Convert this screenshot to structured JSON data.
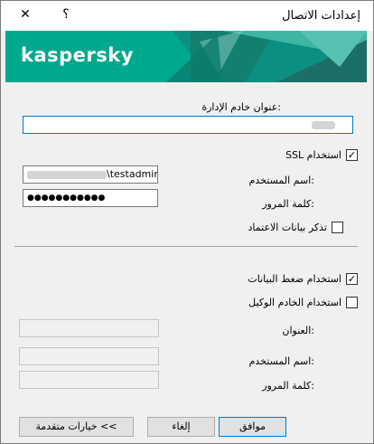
{
  "window": {
    "title": "إعدادات الاتصال",
    "close_symbol": "✕",
    "help_symbol": "؟"
  },
  "banner": {
    "logo_text": "kaspersky",
    "accent_color": "#00a88e"
  },
  "server": {
    "label": "عنوان خادم الإدارة:"
  },
  "ssl": {
    "label": "استخدام SSL",
    "checked": true
  },
  "credentials": {
    "username_label": "اسم المستخدم:",
    "username_value": "\\testadmin",
    "password_label": "كلمة المرور:",
    "password_value": "●●●●●●●●●●●"
  },
  "remember": {
    "label": "تذكر بيانات الاعتماد",
    "checked": false
  },
  "compression": {
    "label": "استخدام ضغط البيانات",
    "checked": true
  },
  "proxy": {
    "label": "استخدام الخادم الوكيل",
    "checked": false,
    "address_label": "العنوان:",
    "username_label": "اسم المستخدم:",
    "password_label": "كلمة المرور:"
  },
  "buttons": {
    "ok": "موافق",
    "cancel": "إلغاء",
    "advanced": "خيارات متقدمة <<"
  }
}
